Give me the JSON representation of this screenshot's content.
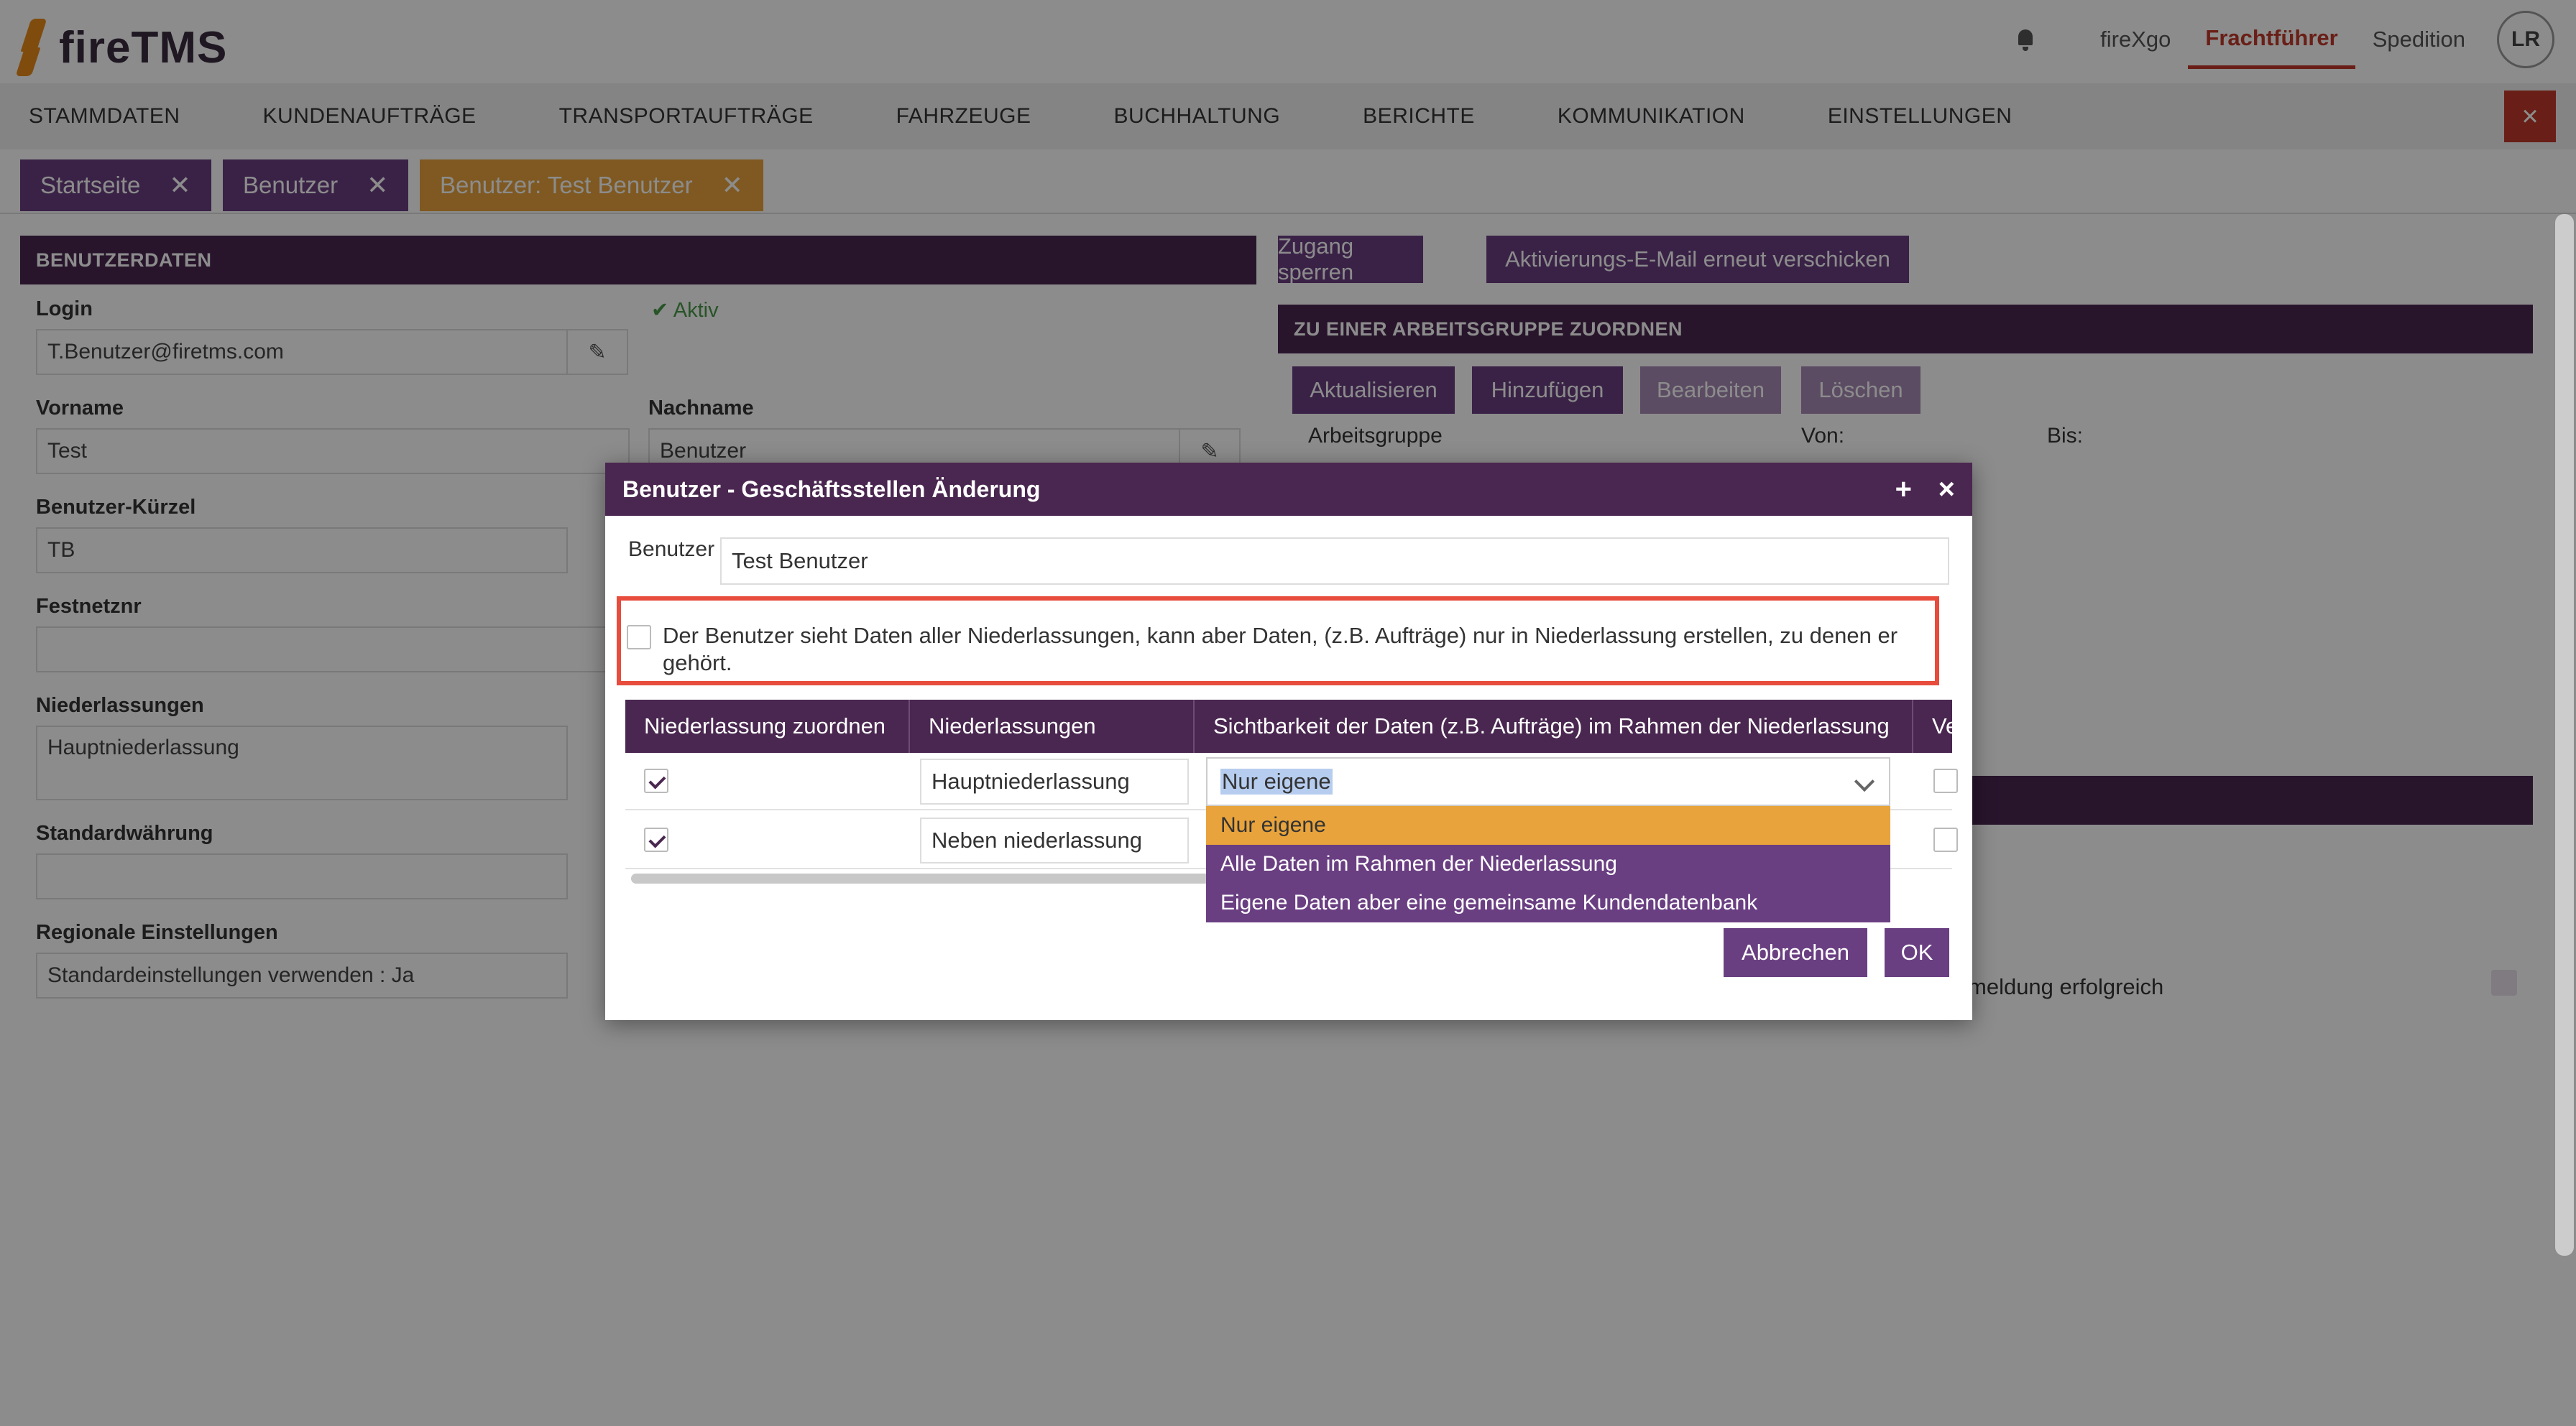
{
  "app": {
    "logo_text": "fireTMS"
  },
  "topbar": {
    "links": [
      "fireXgo",
      "Frachtführer",
      "Spedition"
    ],
    "active_link": "Frachtführer",
    "avatar": "LR"
  },
  "nav": {
    "items": [
      "STAMMDATEN",
      "KUNDENAUFTRÄGE",
      "TRANSPORTAUFTRÄGE",
      "FAHRZEUGE",
      "BUCHHALTUNG",
      "BERICHTE",
      "KOMMUNIKATION",
      "EINSTELLUNGEN"
    ],
    "close": "×"
  },
  "tabs": [
    {
      "label": "Startseite",
      "close": "✕"
    },
    {
      "label": "Benutzer",
      "close": "✕"
    },
    {
      "label": "Benutzer: Test Benutzer",
      "close": "✕"
    }
  ],
  "left_panel": {
    "title": "BENUTZERDATEN",
    "login_label": "Login",
    "login_value": "T.Benutzer@firetms.com",
    "status": "Aktiv",
    "vorname_label": "Vorname",
    "vorname_value": "Test",
    "nachname_label": "Nachname",
    "nachname_value": "Benutzer",
    "kuerzel_label": "Benutzer-Kürzel",
    "kuerzel_value": "TB",
    "festnetz_label": "Festnetznr",
    "niederlassungen_label": "Niederlassungen",
    "niederlassungen_value": "Hauptniederlassung",
    "waehrung_label": "Standardwährung",
    "regional_label": "Regionale Einstellungen",
    "regional_value": "Standardeinstellungen verwenden : Ja"
  },
  "right_panel": {
    "btn_sperren": "Zugang sperren",
    "btn_aktivierung": "Aktivierungs-E-Mail erneut verschicken",
    "group_title": "ZU EINER ARBEITSGRUPPE ZUORDNEN",
    "btn_aktualisieren": "Aktualisieren",
    "btn_hinzufuegen": "Hinzufügen",
    "btn_bearbeiten": "Bearbeiten",
    "btn_loeschen": "Löschen",
    "col_arbeitsgruppe": "Arbeitsgruppe",
    "col_von": "Von:",
    "col_bis": "Bis:",
    "partial_text": "meldung erfolgreich"
  },
  "modal": {
    "title": "Benutzer - Geschäftsstellen Änderung",
    "plus": "+",
    "close": "×",
    "benutzer_label": "Benutzer",
    "benutzer_value": "Test Benutzer",
    "info_text": "Der Benutzer sieht Daten aller Niederlassungen, kann aber Daten, (z.B. Aufträge) nur in Niederlassung erstellen, zu denen er gehört.",
    "columns": [
      "Niederlassung zuordnen",
      "Niederlassungen",
      "Sichtbarkeit der Daten (z.B. Aufträge) im Rahmen der Niederlassung",
      "Ve"
    ],
    "rows": [
      {
        "checked": true,
        "name": "Hauptniederlassung"
      },
      {
        "checked": true,
        "name": "Neben niederlassung"
      }
    ],
    "select_value": "Nur eigene",
    "options": [
      "Nur eigene",
      "Alle Daten im Rahmen der Niederlassung",
      "Eigene Daten aber eine gemeinsame Kundendatenbank"
    ],
    "btn_cancel": "Abbrechen",
    "btn_ok": "OK"
  },
  "colors": {
    "brand": "#4a2750",
    "accent": "#6a3f82",
    "active_tab": "#e8a33c",
    "highlight": "#e74c3c"
  }
}
